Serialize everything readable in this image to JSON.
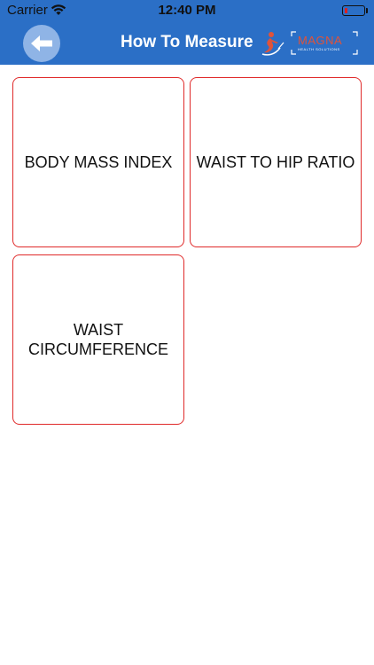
{
  "status_bar": {
    "carrier": "Carrier",
    "time": "12:40 PM",
    "battery_level": 0.15,
    "battery_color": "#e02020"
  },
  "nav": {
    "title": "How To Measure",
    "back_icon": "arrow-left-icon",
    "background_color": "#2b6fc6"
  },
  "logo": {
    "name": "MAGNA",
    "tagline": "HEALTH SOLUTIONS",
    "name_color": "#e0533a"
  },
  "tiles": [
    {
      "label": "BODY MASS INDEX"
    },
    {
      "label": "WAIST TO HIP RATIO"
    },
    {
      "label": "WAIST CIRCUMFERENCE"
    }
  ],
  "tile_border_color": "#e02a2a"
}
